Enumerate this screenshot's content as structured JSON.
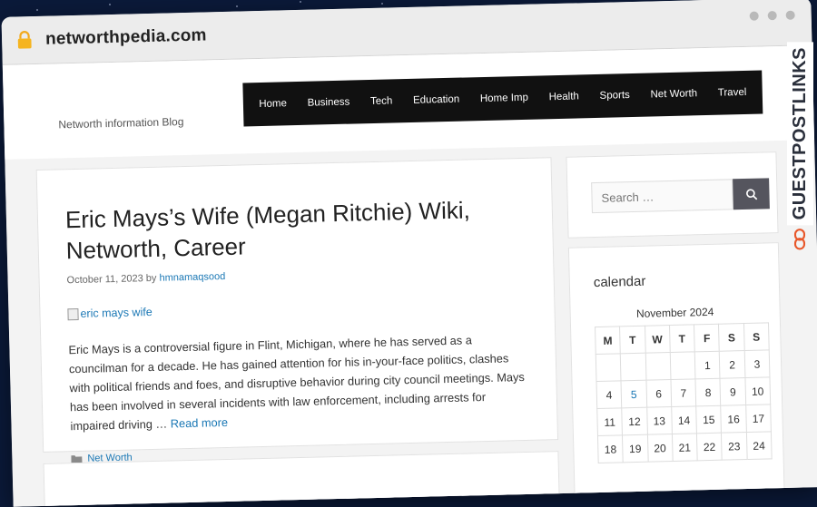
{
  "browser": {
    "url": "networthpedia.com"
  },
  "site": {
    "tagline": "Networth information Blog",
    "nav": [
      "Home",
      "Business",
      "Tech",
      "Education",
      "Home Imp",
      "Health",
      "Sports",
      "Net Worth",
      "Travel"
    ]
  },
  "article": {
    "title": "Eric Mays’s Wife (Megan Ritchie) Wiki, Networth, Career",
    "date": "October 11, 2023",
    "by": "by",
    "author": "hmnamaqsood",
    "image_alt": "eric mays wife",
    "excerpt": "Eric Mays is a controversial figure in Flint, Michigan, where he has served as a councilman for a decade. He has gained attention for his in-your-face politics, clashes with political friends and foes, and disruptive behavior during city council meetings. Mays has been involved in several incidents with law enforcement, including arrests for impaired driving …",
    "read_more": "Read more",
    "category": "Net Worth"
  },
  "search": {
    "placeholder": "Search …"
  },
  "calendar": {
    "widget_title": "calendar",
    "caption": "November 2024",
    "days": [
      "M",
      "T",
      "W",
      "T",
      "F",
      "S",
      "S"
    ],
    "rows": [
      [
        "",
        "",
        "",
        "",
        "1",
        "2",
        "3"
      ],
      [
        "4",
        "5",
        "6",
        "7",
        "8",
        "9",
        "10"
      ],
      [
        "11",
        "12",
        "13",
        "14",
        "15",
        "16",
        "17"
      ],
      [
        "18",
        "19",
        "20",
        "21",
        "22",
        "23",
        "24"
      ]
    ],
    "linked_day": "5"
  },
  "badge": {
    "text": "GUESTPOSTLINKS"
  },
  "colors": {
    "link": "#1b78b5",
    "nav_bg": "#111111",
    "badge_accent": "#e8572a"
  }
}
